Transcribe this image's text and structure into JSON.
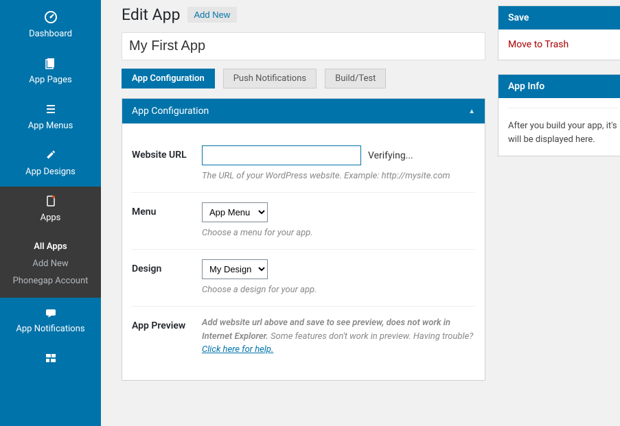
{
  "sidebar": {
    "items": [
      {
        "label": "Dashboard",
        "icon": "dashboard"
      },
      {
        "label": "App Pages",
        "icon": "pages"
      },
      {
        "label": "App Menus",
        "icon": "menus"
      },
      {
        "label": "App Designs",
        "icon": "designs"
      },
      {
        "label": "Apps",
        "icon": "apps"
      },
      {
        "label": "App Notifications",
        "icon": "notifications"
      },
      {
        "label": "",
        "icon": "settings"
      }
    ],
    "sub": [
      {
        "label": "All Apps",
        "active": true
      },
      {
        "label": "Add New",
        "active": false
      },
      {
        "label": "Phonegap Account",
        "active": false
      }
    ]
  },
  "header": {
    "title": "Edit App",
    "add_new": "Add New"
  },
  "title_input": {
    "value": "My First App"
  },
  "tabs": [
    {
      "label": "App Configuration",
      "active": true
    },
    {
      "label": "Push Notifications",
      "active": false
    },
    {
      "label": "Build/Test",
      "active": false
    }
  ],
  "panel": {
    "title": "App Configuration"
  },
  "fields": {
    "url": {
      "label": "Website URL",
      "value": "",
      "status": "Verifying...",
      "help": "The URL of your WordPress website. Example: http://mysite.com"
    },
    "menu": {
      "label": "Menu",
      "selected": "App Menu",
      "help": "Choose a menu for your app."
    },
    "design": {
      "label": "Design",
      "selected": "My Design",
      "help": "Choose a design for your app."
    },
    "preview": {
      "label": "App Preview",
      "text_bold": "Add website url above and save to see preview, does not work in Internet Explorer.",
      "text_rest": " Some features don't work in preview. Having trouble? ",
      "link": "Click here for help."
    }
  },
  "metabox_save": {
    "title": "Save",
    "trash": "Move to Trash"
  },
  "metabox_info": {
    "title": "App Info",
    "text": "After you build your app, it's will be displayed here."
  }
}
